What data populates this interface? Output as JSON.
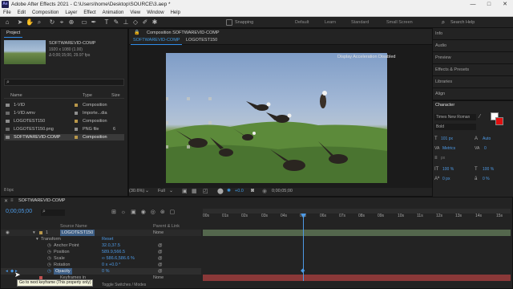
{
  "window": {
    "title": "Adobe After Effects 2021 - C:\\Users\\home\\Desktop\\SOURCE\\3.aep *",
    "logo": "Ae",
    "controls": [
      "—",
      "□",
      "✕"
    ]
  },
  "menu": [
    "File",
    "Edit",
    "Composition",
    "Layer",
    "Effect",
    "Animation",
    "View",
    "Window",
    "Help"
  ],
  "toolbar": {
    "snapping": "Snapping",
    "workspaces": [
      "Default",
      "Learn",
      "Standard",
      "Small Screen"
    ],
    "search_placeholder": "Search Help"
  },
  "project": {
    "tab": "Project",
    "comp_name": "SOFTWAREVID-COMP",
    "comp_size": "1920 x 1080 (1.00)",
    "comp_duration": "Δ 0;00;15;00, 29.97 fps",
    "columns": {
      "name": "Name",
      "type": "Type",
      "size": "Size"
    },
    "items": [
      {
        "name": "1-VID",
        "type": "Composition",
        "size": "",
        "color": "#b8974a",
        "selected": false
      },
      {
        "name": "1-VID.wmv",
        "type": "Importe...dia",
        "size": "",
        "color": "#8e8e8e",
        "selected": false
      },
      {
        "name": "LOGOTEST150",
        "type": "Composition",
        "size": "",
        "color": "#b8974a",
        "selected": false
      },
      {
        "name": "LOGOTEST150.png",
        "type": "PNG file",
        "size": "6",
        "color": "#8e8e8e",
        "selected": false
      },
      {
        "name": "SOFTWAREVID-COMP",
        "type": "Composition",
        "size": "",
        "color": "#b8974a",
        "selected": true
      }
    ],
    "bpc": "8 bpc"
  },
  "composition": {
    "header": "Composition SOFTWAREVID-COMP",
    "tabs": [
      "SOFTWAREVID-COMP",
      "LOGOTEST150"
    ],
    "notice": "Display Acceleration Disabled",
    "zoom": "(30.6%)",
    "resolution": "Full",
    "exposure": "+0.0",
    "timecode": "0;00;05;00"
  },
  "right_panels": [
    "Info",
    "Audio",
    "Preview",
    "Effects & Presets",
    "Libraries",
    "Align"
  ],
  "character": {
    "tab": "Character",
    "font": "Times New Roman",
    "style": "Bold",
    "size": "101 px",
    "leading": "Auto",
    "kerning": "Metrics",
    "tracking": "0",
    "stroke": "px",
    "vscale": "100 %",
    "hscale": "100 %",
    "baseline": "0 px",
    "tsume": "0 %",
    "colors": {
      "fill": "#ffffff",
      "stroke": "#e01010"
    }
  },
  "timeline": {
    "tab": "SOFTWAREVID-COMP",
    "timecode": "0;00;05;00",
    "source_col": "Source Name",
    "parent_col": "Parent & Link",
    "layer": {
      "num": "1",
      "name": "LOGOTEST150",
      "parent": "None"
    },
    "layer2": {
      "parent": "None"
    },
    "transform": "Transform",
    "reset": "Reset",
    "properties": [
      {
        "name": "Anchor Point",
        "value": "32.0,37.5"
      },
      {
        "name": "Position",
        "value": "589.9,566.5"
      },
      {
        "name": "Scale",
        "value": "∞ 586.6,586.6 %"
      },
      {
        "name": "Rotation",
        "value": "0 x +0.0 °"
      },
      {
        "name": "Opacity",
        "value": "0 %"
      }
    ],
    "keyframes_label": "Keyframes in",
    "tooltip": "Go to next keyframe (This property only)",
    "toggle": "Toggle Switches / Modes",
    "ruler": [
      "00s",
      "01s",
      "02s",
      "03s",
      "04s",
      "05s",
      "06s",
      "07s",
      "08s",
      "09s",
      "10s",
      "11s",
      "12s",
      "13s",
      "14s",
      "15s"
    ]
  }
}
